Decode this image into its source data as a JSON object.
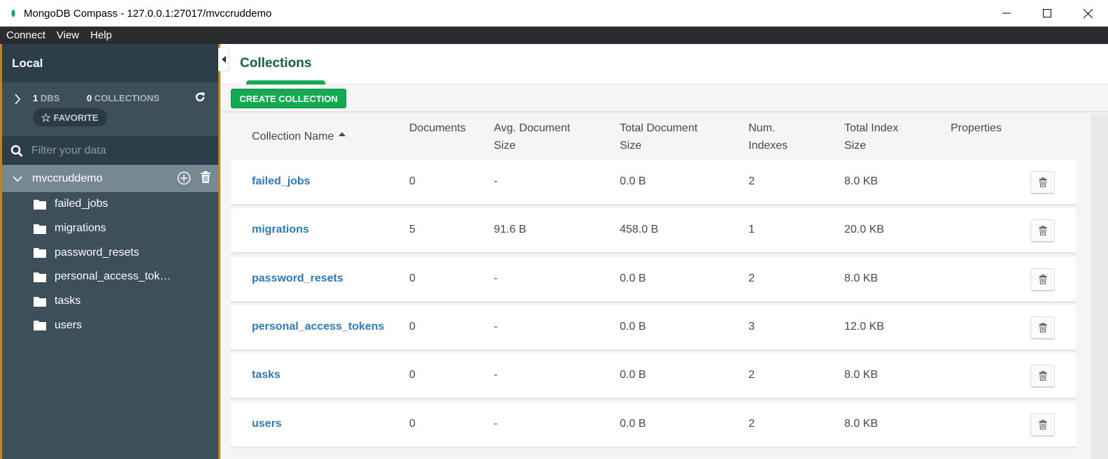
{
  "window": {
    "title": "MongoDB Compass - 127.0.0.1:27017/mvccruddemo",
    "minimize_icon": "minimize-icon",
    "maximize_icon": "maximize-icon",
    "close_icon": "close-icon"
  },
  "menubar": {
    "items": [
      "Connect",
      "View",
      "Help"
    ]
  },
  "sidebar": {
    "connection_name": "Local",
    "dbs_count": "1",
    "dbs_label": "DBS",
    "collections_count": "0",
    "collections_label": "COLLECTIONS",
    "favorite_label": "FAVORITE",
    "filter_placeholder": "Filter your data",
    "database": {
      "name": "mvccruddemo",
      "collections": [
        "failed_jobs",
        "migrations",
        "password_resets",
        "personal_access_tok…",
        "tasks",
        "users"
      ]
    }
  },
  "main": {
    "tab_label": "Collections",
    "create_button": "CREATE COLLECTION",
    "columns": [
      {
        "line1": "Collection Name",
        "line2": ""
      },
      {
        "line1": "Documents",
        "line2": ""
      },
      {
        "line1": "Avg. Document",
        "line2": "Size"
      },
      {
        "line1": "Total Document",
        "line2": "Size"
      },
      {
        "line1": "Num.",
        "line2": "Indexes"
      },
      {
        "line1": "Total Index",
        "line2": "Size"
      },
      {
        "line1": "Properties",
        "line2": ""
      }
    ],
    "sort_indicator": "ascending",
    "rows": [
      {
        "name": "failed_jobs",
        "documents": "0",
        "avg_size": "-",
        "total_size": "0.0 B",
        "num_indexes": "2",
        "index_size": "8.0 KB"
      },
      {
        "name": "migrations",
        "documents": "5",
        "avg_size": "91.6 B",
        "total_size": "458.0 B",
        "num_indexes": "1",
        "index_size": "20.0 KB"
      },
      {
        "name": "password_resets",
        "documents": "0",
        "avg_size": "-",
        "total_size": "0.0 B",
        "num_indexes": "2",
        "index_size": "8.0 KB"
      },
      {
        "name": "personal_access_tokens",
        "documents": "0",
        "avg_size": "-",
        "total_size": "0.0 B",
        "num_indexes": "3",
        "index_size": "12.0 KB"
      },
      {
        "name": "tasks",
        "documents": "0",
        "avg_size": "-",
        "total_size": "0.0 B",
        "num_indexes": "2",
        "index_size": "8.0 KB"
      },
      {
        "name": "users",
        "documents": "0",
        "avg_size": "-",
        "total_size": "0.0 B",
        "num_indexes": "2",
        "index_size": "8.0 KB"
      }
    ]
  },
  "colors": {
    "accent_green": "#13aa52",
    "tab_green": "#116149",
    "link_blue": "#2e7ab8",
    "sidebar_bg": "#3d4f58",
    "sidebar_dark": "#2c3e4a"
  }
}
